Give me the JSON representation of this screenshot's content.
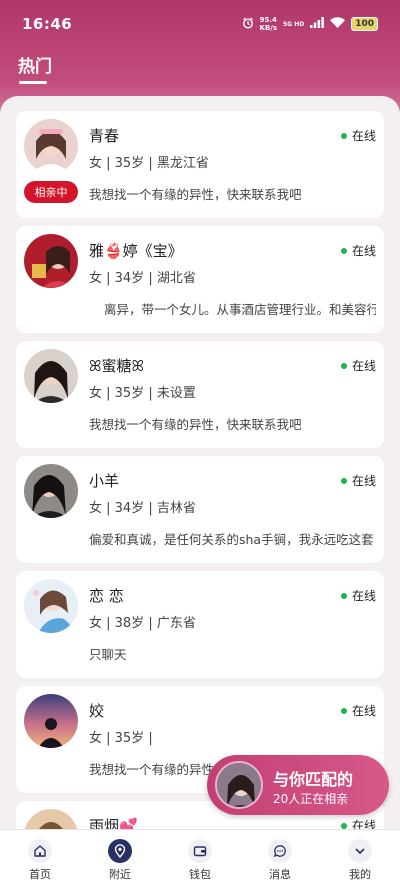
{
  "status_bar": {
    "time": "16:46",
    "net_speed_value": "95.4",
    "net_speed_unit": "KB/s",
    "signal_label": "5G HD",
    "battery": "100"
  },
  "header": {
    "title": "热门"
  },
  "profiles": [
    {
      "name": "青春",
      "meta": "女 | 35岁 | 黑龙江省",
      "bio": "我想找一个有缘的异性，快来联系我吧",
      "status": "在线",
      "badge": "相亲中"
    },
    {
      "name": "雅👙婷《宝》",
      "meta": "女 | 34岁 | 湖北省",
      "bio": "离异，带一个女儿。从事酒店管理行业。和美容行业",
      "status": "在线"
    },
    {
      "name": "ꕤ蜜糖ꕤ",
      "meta": "女 | 35岁 | 未设置",
      "bio": "我想找一个有缘的异性，快来联系我吧",
      "status": "在线"
    },
    {
      "name": "小羊",
      "meta": "女 | 34岁 | 吉林省",
      "bio": "偏爱和真诚，是任何关系的sha手锏，我永远吃这套",
      "status": "在线"
    },
    {
      "name": "恋 恋",
      "meta": "女 | 38岁 | 广东省",
      "bio": "只聊天",
      "status": "在线"
    },
    {
      "name": "姣",
      "meta": "女 | 35岁 |",
      "bio": "我想找一个有缘的异性，快来联系我吧",
      "status": "在线"
    },
    {
      "name": "雨烟💕",
      "meta": "",
      "bio": "",
      "status": "在线"
    }
  ],
  "match_popup": {
    "title": "与你匹配的",
    "subtitle": "20人正在相亲"
  },
  "tabbar": {
    "items": [
      {
        "label": "首页",
        "icon": "home-icon"
      },
      {
        "label": "附近",
        "icon": "location-icon",
        "active": true
      },
      {
        "label": "钱包",
        "icon": "wallet-icon"
      },
      {
        "label": "消息",
        "icon": "message-icon"
      },
      {
        "label": "我的",
        "icon": "profile-icon"
      }
    ]
  },
  "colors": {
    "accent": "#c23f72",
    "badge_red": "#d4142a",
    "online_green": "#22b14c",
    "tab_active": "#283163"
  }
}
